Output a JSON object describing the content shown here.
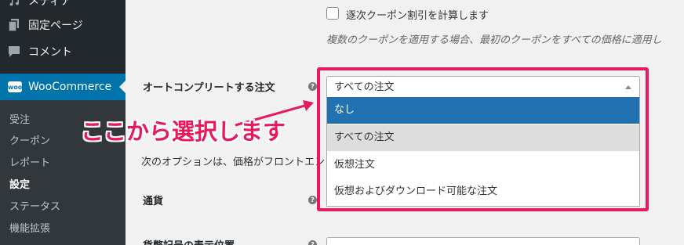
{
  "sidebar": {
    "top_items": [
      {
        "label": "メディア",
        "icon": "media-icon"
      },
      {
        "label": "固定ページ",
        "icon": "pages-icon"
      },
      {
        "label": "コメント",
        "icon": "comments-icon"
      }
    ],
    "active_item": {
      "label": "WooCommerce",
      "icon": "woo",
      "icon_text": "woo"
    },
    "submenu": [
      "受注",
      "クーポン",
      "レポート",
      "設定",
      "ステータス",
      "機能拡張"
    ],
    "current_submenu": "設定"
  },
  "settings": {
    "sequential_coupon": {
      "label": "逐次クーポン割引を計算します",
      "checked": false
    },
    "sequential_coupon_desc": "複数のクーポンを適用する場合、最初のクーポンをすべての価格に適用し",
    "autocomplete": {
      "label": "オートコンプリートする注文",
      "help": "?",
      "selected": "すべての注文",
      "options": [
        "なし",
        "すべての注文",
        "仮想注文",
        "仮想およびダウンロード可能な注文"
      ],
      "highlighted_option": "なし"
    },
    "currency_intro": "次のオプションは、価格がフロントエン",
    "currency": {
      "label": "通貨",
      "help": "?"
    },
    "currency_position": {
      "label": "貨幣記号の表示位置",
      "help": "?"
    }
  },
  "annotation": {
    "text": "ここから選択します",
    "color": "#e8195a"
  },
  "colors": {
    "sidebar_bg": "#23282d",
    "active_blue": "#0073aa",
    "highlight": "#2271b1",
    "annotation": "#e8195a"
  }
}
